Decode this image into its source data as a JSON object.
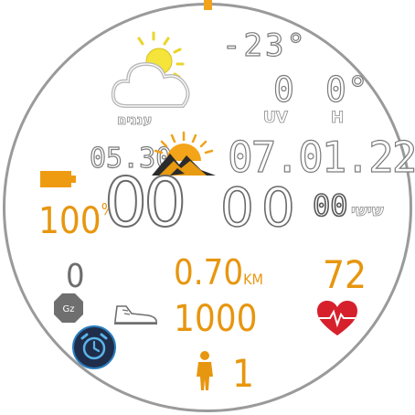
{
  "watchface": {
    "accent_color": "#e7960f",
    "weather": {
      "icon": "partly-cloudy-icon",
      "condition_label": "עננים",
      "temperature": "-23°",
      "uv_value": "0",
      "uv_label": "UV",
      "humidity_value": "0°",
      "humidity_label": "H"
    },
    "sunrise": {
      "icon": "sunrise-icon",
      "time": "05.30"
    },
    "date": {
      "text": "07.01.22"
    },
    "battery": {
      "icon": "battery-icon",
      "percent": "100",
      "unit": "%"
    },
    "time": {
      "hours": "00",
      "minutes": "00",
      "seconds": "00",
      "day_name": "שישי"
    },
    "stats": {
      "stand_count": "0",
      "stand_icon": "stand-badge-icon",
      "distance_value": "0.70",
      "distance_unit": "KM",
      "steps_icon": "sneaker-icon",
      "steps": "1000",
      "heart_icon": "heart-pulse-icon",
      "heart_rate": "72",
      "alarm_icon": "alarm-clock-icon",
      "person_icon": "person-icon",
      "person_count": "1"
    }
  }
}
